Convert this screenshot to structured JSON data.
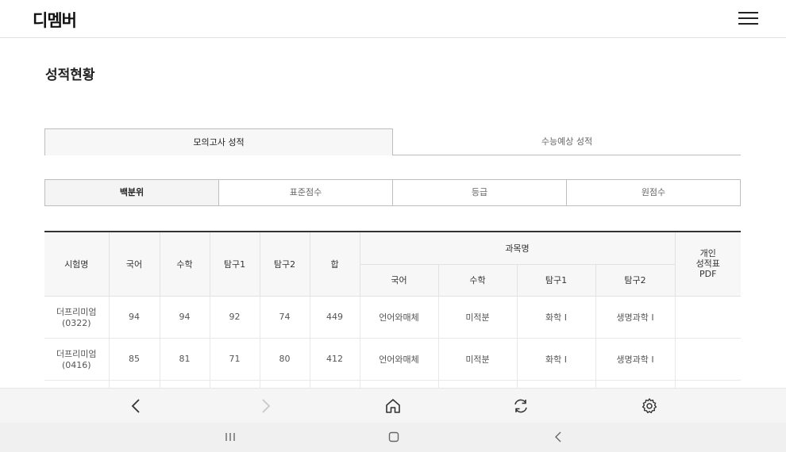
{
  "header": {
    "logo": "디멤버"
  },
  "page": {
    "title": "성적현황"
  },
  "main_tabs": [
    {
      "label": "모의고사 성적",
      "active": true
    },
    {
      "label": "수능예상 성적",
      "active": false
    }
  ],
  "sub_tabs": [
    {
      "label": "백분위",
      "active": true
    },
    {
      "label": "표준점수",
      "active": false
    },
    {
      "label": "등급",
      "active": false
    },
    {
      "label": "원점수",
      "active": false
    }
  ],
  "table": {
    "headers": {
      "exam": "시험명",
      "korean": "국어",
      "math": "수학",
      "inquiry1": "탐구1",
      "inquiry2": "탐구2",
      "total": "합",
      "subject_group": "과목명",
      "sub_korean": "국어",
      "sub_math": "수학",
      "sub_inquiry1": "탐구1",
      "sub_inquiry2": "탐구2",
      "pdf_line1": "개인",
      "pdf_line2": "성적표",
      "pdf_line3": "PDF"
    },
    "rows": [
      {
        "exam_name": "더프리미엄",
        "exam_date": "(0322)",
        "korean": "94",
        "math": "94",
        "inquiry1": "92",
        "inquiry2": "74",
        "total": "449",
        "sub_korean": "언어와매체",
        "sub_math": "미적분",
        "sub_inquiry1": "화학 Ⅰ",
        "sub_inquiry2": "생명과학 Ⅰ"
      },
      {
        "exam_name": "더프리미엄",
        "exam_date": "(0416)",
        "korean": "85",
        "math": "81",
        "inquiry1": "71",
        "inquiry2": "80",
        "total": "412",
        "sub_korean": "언어와매체",
        "sub_math": "미적분",
        "sub_inquiry1": "화학 Ⅰ",
        "sub_inquiry2": "생명과학 Ⅰ"
      }
    ]
  },
  "icons": {
    "back": "chevron-left-icon",
    "forward": "chevron-right-icon",
    "home": "home-icon",
    "refresh": "refresh-icon",
    "settings": "gear-icon"
  }
}
